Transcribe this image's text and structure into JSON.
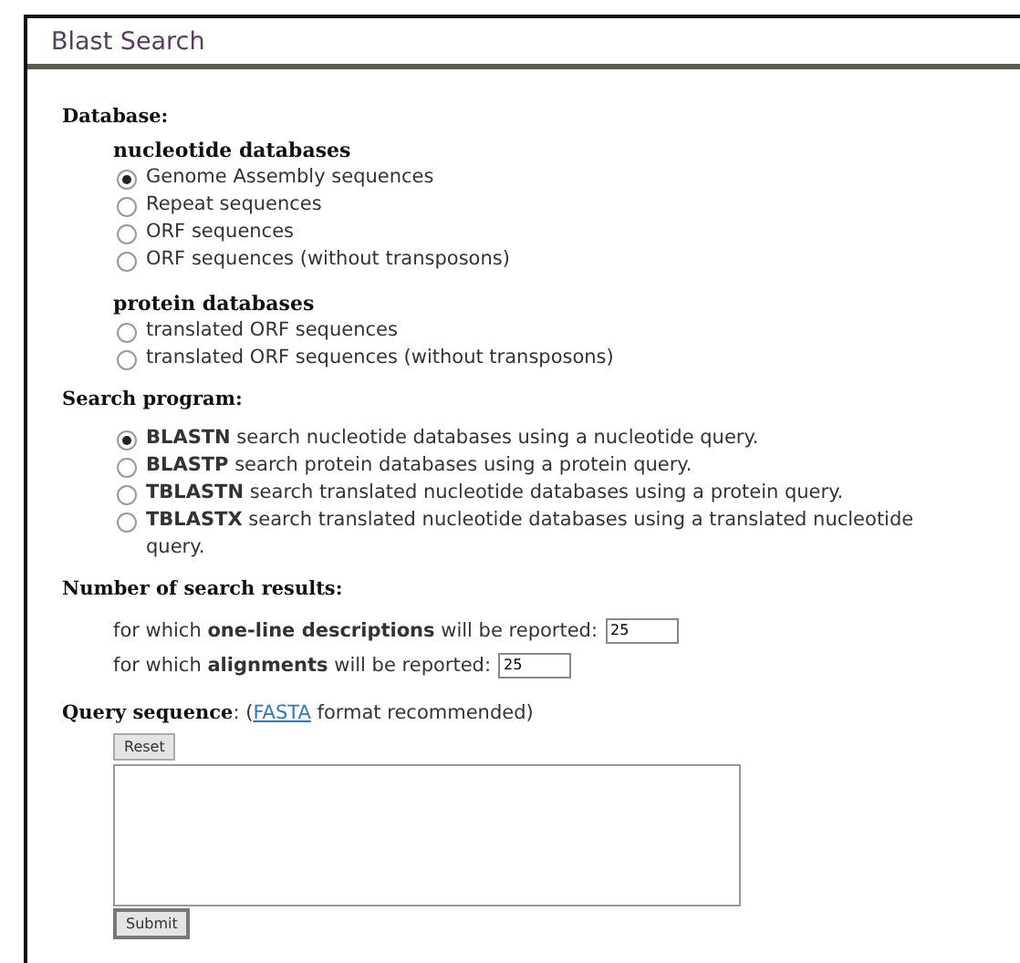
{
  "window": {
    "title": "Blast Search"
  },
  "database": {
    "heading": "Database:",
    "groups": [
      {
        "heading": "nucleotide databases",
        "options": [
          {
            "label": "Genome Assembly sequences",
            "selected": true
          },
          {
            "label": "Repeat sequences",
            "selected": false
          },
          {
            "label": "ORF sequences",
            "selected": false
          },
          {
            "label": "ORF sequences (without transposons)",
            "selected": false
          }
        ]
      },
      {
        "heading": "protein databases",
        "options": [
          {
            "label": "translated ORF sequences",
            "selected": false
          },
          {
            "label": "translated ORF sequences (without transposons)",
            "selected": false
          }
        ]
      }
    ]
  },
  "program": {
    "heading": "Search program:",
    "options": [
      {
        "label": "**BLASTN** search nucleotide databases using a nucleotide query.",
        "selected": true
      },
      {
        "label": "**BLASTP** search protein databases using a protein query.",
        "selected": false
      },
      {
        "label": "**TBLASTN** search translated nucleotide databases using a protein query.",
        "selected": false
      },
      {
        "label": "**TBLASTX** search translated nucleotide databases using a translated nucleotide query.",
        "selected": false
      }
    ]
  },
  "results": {
    "heading": "Number of search results:",
    "fields": [
      {
        "label": "for which **one-line descriptions** will be reported:",
        "value": "25"
      },
      {
        "label": "for which **alignments** will be reported:",
        "value": "25"
      }
    ]
  },
  "query": {
    "label": "**Query sequence**: (",
    "link": "FASTA",
    "after": " format recommended)",
    "reset": "Reset",
    "submit": "Submit"
  }
}
